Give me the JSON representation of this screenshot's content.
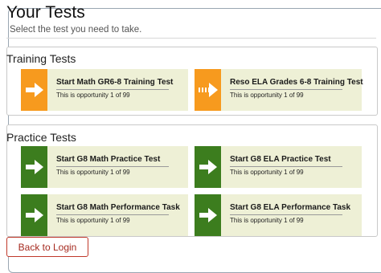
{
  "page": {
    "title": "Your Tests",
    "instructions": "Select the test you need to take."
  },
  "training": {
    "title": "Training Tests",
    "tiles": [
      {
        "name": "Start Math GR6-8 Training Test",
        "opportunity": "This is opportunity 1 of 99",
        "icon": "arrow-right-icon",
        "color": "#f79a1e"
      },
      {
        "name": "Reso   ELA Grades 6-8 Training Test",
        "opportunity": "This is opportunity 1 of 99",
        "icon": "resume-arrow-icon",
        "color": "#f79a1e"
      }
    ]
  },
  "practice": {
    "title": "Practice Tests",
    "tiles": [
      {
        "name": "Start G8 Math Practice Test",
        "opportunity": "This is opportunity 1 of 99",
        "icon": "arrow-right-icon",
        "color": "#3c7d1e"
      },
      {
        "name": "Start G8 ELA Practice Test",
        "opportunity": "This is opportunity 1 of 99",
        "icon": "arrow-right-icon",
        "color": "#3c7d1e"
      },
      {
        "name": "Start G8 Math Performance Task",
        "opportunity": "This is opportunity 1 of 99",
        "icon": "arrow-right-icon",
        "color": "#3c7d1e"
      },
      {
        "name": "Start G8 ELA Performance Task",
        "opportunity": "This is opportunity 1 of 99",
        "icon": "arrow-right-icon",
        "color": "#3c7d1e"
      }
    ]
  },
  "actions": {
    "back_label": "Back to Login"
  }
}
